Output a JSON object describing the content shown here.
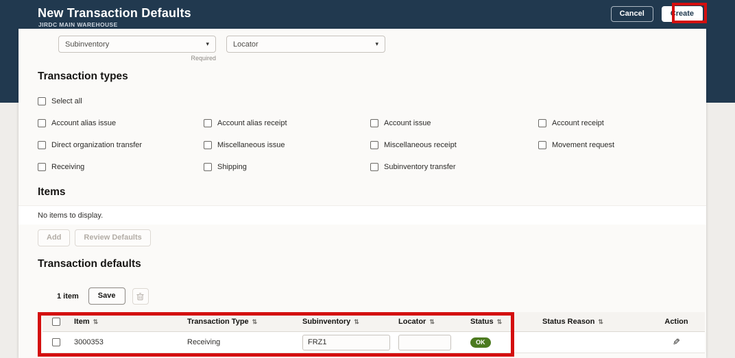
{
  "header": {
    "title": "New Transaction Defaults",
    "subtitle": "JIRDC MAIN WAREHOUSE",
    "cancel_label": "Cancel",
    "create_label": "Create"
  },
  "filters": {
    "subinventory_label": "Subinventory",
    "subinventory_required_hint": "Required",
    "locator_label": "Locator",
    "caret_icon": "▾"
  },
  "transaction_types": {
    "heading": "Transaction types",
    "select_all_label": "Select all",
    "options": [
      "Account alias issue",
      "Account alias receipt",
      "Account issue",
      "Account receipt",
      "Direct organization transfer",
      "Miscellaneous issue",
      "Miscellaneous receipt",
      "Movement request",
      "Receiving",
      "Shipping",
      "Subinventory transfer"
    ]
  },
  "items_section": {
    "heading": "Items",
    "empty_message": "No items to display.",
    "add_label": "Add",
    "review_defaults_label": "Review Defaults"
  },
  "defaults_section": {
    "heading": "Transaction defaults",
    "count_label": "1 item",
    "save_label": "Save",
    "sort_icon": "⇅",
    "pencil_icon": "✎",
    "table": {
      "columns": {
        "item": "Item",
        "transaction_type": "Transaction Type",
        "subinventory": "Subinventory",
        "locator": "Locator",
        "status": "Status",
        "status_reason": "Status Reason",
        "action": "Action"
      },
      "rows": [
        {
          "item": "3000353",
          "transaction_type": "Receiving",
          "subinventory": "FRZ1",
          "locator": "",
          "status": "OK",
          "status_reason": ""
        }
      ]
    }
  },
  "colors": {
    "header_navy": "#21394f",
    "panel_background": "#fbfaf8",
    "status_ok_green": "#4c7a1f",
    "annotation_red": "#d40f0f"
  }
}
